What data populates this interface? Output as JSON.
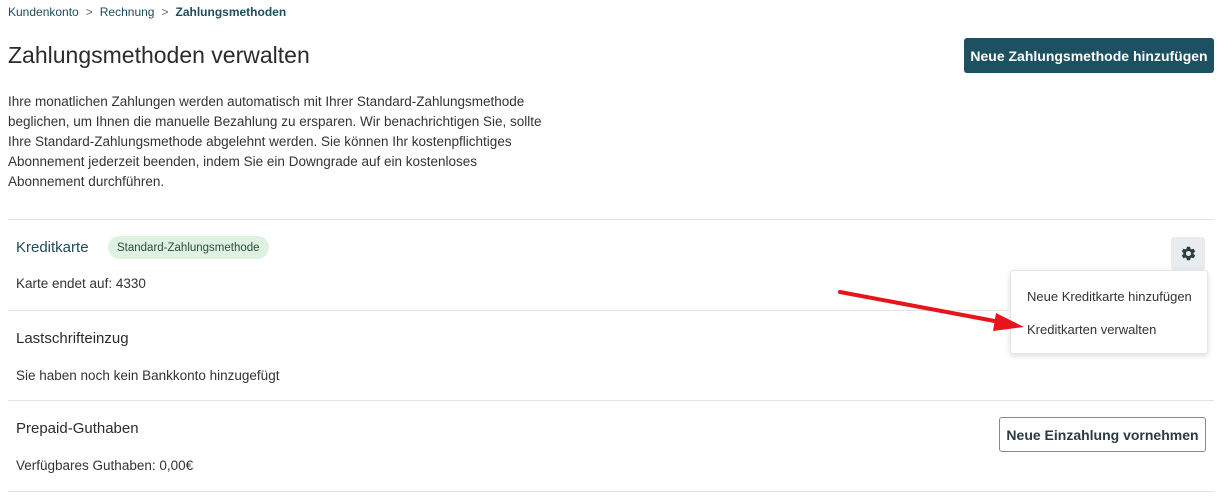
{
  "breadcrumb": {
    "items": [
      "Kundenkonto",
      "Rechnung"
    ],
    "separator": ">",
    "current": "Zahlungsmethoden"
  },
  "header": {
    "title": "Zahlungsmethoden verwalten",
    "add_button_label": "Neue Zahlungsmethode hinzufügen"
  },
  "intro": {
    "text": "Ihre monatlichen Zahlungen werden automatisch mit Ihrer Standard-Zahlungsmethode beglichen, um Ihnen die manuelle Bezahlung zu ersparen. Wir benachrichtigen Sie, sollte Ihre Standard-Zahlungsmethode abgelehnt werden. Sie können Ihr kostenpflichtiges Abonnement jederzeit beenden, indem Sie ein Downgrade auf ein kostenloses Abonnement durchführen."
  },
  "sections": {
    "credit_card": {
      "title": "Kreditkarte",
      "badge": "Standard-Zahlungsmethode",
      "detail": "Karte endet auf: 4330",
      "settings_icon": "gear-icon",
      "menu": [
        "Neue Kreditkarte hinzufügen",
        "Kreditkarten verwalten"
      ]
    },
    "direct_debit": {
      "title": "Lastschrifteinzug",
      "detail": "Sie haben noch kein Bankkonto hinzugefügt"
    },
    "prepaid": {
      "title": "Prepaid-Guthaben",
      "detail": "Verfügbares Guthaben: 0,00€",
      "button_label": "Neue Einzahlung vornehmen"
    }
  },
  "colors": {
    "brand": "#1d5060",
    "badge_bg": "#dff2e1",
    "annotation_arrow": "#e8141b"
  }
}
